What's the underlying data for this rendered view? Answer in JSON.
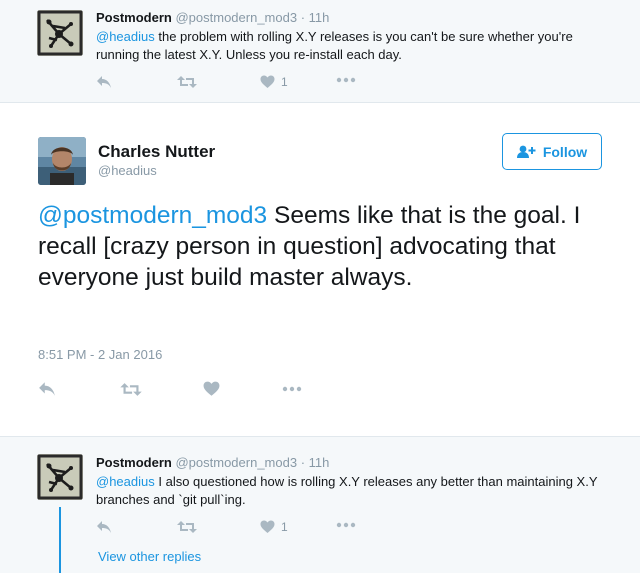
{
  "tweets": {
    "parent": {
      "name": "Postmodern",
      "handle": "@postmodern_mod3",
      "separator": "·",
      "time": "11h",
      "mention": "@headius",
      "text": " the problem with rolling X.Y releases is you can't be sure whether you're running the latest X.Y. Unless you re-install each day.",
      "like_count": "1"
    },
    "focused": {
      "name": "Charles Nutter",
      "handle": "@headius",
      "follow_label": "Follow",
      "mention": "@postmodern_mod3",
      "text": " Seems like that is the goal. I recall [crazy person in question] advocating that everyone just build master always.",
      "timestamp": "8:51 PM - 2 Jan 2016"
    },
    "reply": {
      "name": "Postmodern",
      "handle": "@postmodern_mod3",
      "separator": "·",
      "time": "11h",
      "mention": "@headius",
      "text": " I also questioned how is rolling X.Y releases any better than maintaining X.Y branches and `git pull`ing.",
      "like_count": "1",
      "view_replies_label": "View other replies"
    }
  },
  "icons": {
    "reply": "reply-icon",
    "retweet": "retweet-icon",
    "like": "heart-icon",
    "more": "more-icon",
    "follow": "add-user-icon"
  },
  "colors": {
    "link": "#1b95e0",
    "muted": "#8899a6",
    "icon": "#aab8c2",
    "thread_bg": "#f5f8fa"
  }
}
